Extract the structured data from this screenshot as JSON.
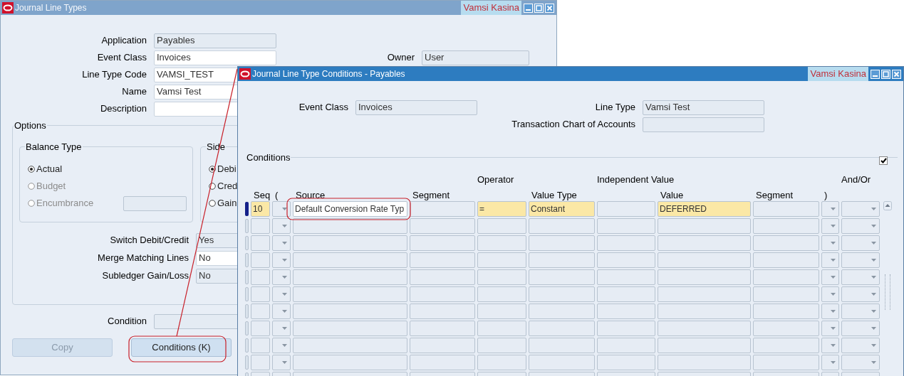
{
  "back_window": {
    "title": "Journal Line Types",
    "user": "Vamsi Kasina",
    "active": false,
    "fields": [
      {
        "label": "Application",
        "value": "Payables",
        "editable": false
      },
      {
        "label": "Event Class",
        "value": "Invoices",
        "editable": true
      },
      {
        "label": "Line Type Code",
        "value": "VAMSI_TEST",
        "editable": true
      },
      {
        "label": "Name",
        "value": "Vamsi Test",
        "editable": true
      },
      {
        "label": "Description",
        "editable": true
      }
    ],
    "owner": {
      "label": "Owner",
      "value": "User",
      "editable": false
    },
    "options": {
      "title": "Options",
      "balance_type": {
        "title": "Balance Type",
        "radios": [
          {
            "label": "Actual",
            "selected": true,
            "disabled": false
          },
          {
            "label": "Budget",
            "selected": false,
            "disabled": true
          },
          {
            "label": "Encumbrance",
            "selected": false,
            "disabled": true,
            "field": {
              "editable": false
            }
          }
        ]
      },
      "side": {
        "title": "Side",
        "radios": [
          {
            "label": "Debi",
            "selected": true,
            "disabled": false
          },
          {
            "label": "Cred",
            "selected": false,
            "disabled": false
          },
          {
            "label": "Gain",
            "selected": false,
            "disabled": false
          }
        ]
      },
      "settings": [
        {
          "label": "Switch Debit/Credit",
          "value": "Yes",
          "editable": false
        },
        {
          "label": "Merge Matching Lines",
          "value": "No",
          "editable": true
        },
        {
          "label": "Subledger Gain/Loss",
          "value": "No",
          "editable": false
        }
      ]
    },
    "condition": {
      "label": "Condition",
      "editable": false
    },
    "buttons": [
      {
        "label": "Copy",
        "disabled": true
      },
      {
        "label": "Conditions (K)",
        "disabled": false
      }
    ]
  },
  "front_window": {
    "title": "Journal Line Type Conditions - Payables",
    "user": "Vamsi Kasina",
    "active": true,
    "left_fields": [
      {
        "label": "Event Class",
        "value": "Invoices"
      }
    ],
    "right_fields": [
      {
        "label": "Line Type",
        "value": "Vamsi Test"
      },
      {
        "label": "Transaction Chart of Accounts"
      }
    ],
    "conditions": {
      "title": "Conditions",
      "checked": true,
      "columns": [
        {
          "label": "Seq",
          "kind": "text",
          "required": true
        },
        {
          "label": "(",
          "kind": "dropdown"
        },
        {
          "label": "Source",
          "kind": "lov"
        },
        {
          "label": "Segment",
          "kind": "text"
        },
        {
          "group": "Operator",
          "kind": "text",
          "required": true
        },
        {
          "label": "Value Type",
          "kind": "text",
          "required": true
        },
        {
          "group": "Independent Value",
          "kind": "text"
        },
        {
          "label": "Value",
          "kind": "text",
          "required": true
        },
        {
          "label": "Segment",
          "kind": "text"
        },
        {
          "label": ")",
          "kind": "dropdown"
        },
        {
          "group": "And/Or",
          "kind": "dropdown"
        }
      ],
      "rows": [
        {
          "selected": true,
          "cells": [
            "10",
            null,
            "Default Conversion Rate Typ",
            null,
            "=",
            "Constant",
            null,
            "DEFERRED",
            null,
            null,
            null
          ]
        },
        {
          "selected": false
        },
        {
          "selected": false
        },
        {
          "selected": false
        },
        {
          "selected": false
        },
        {
          "selected": false
        },
        {
          "selected": false
        },
        {
          "selected": false
        },
        {
          "selected": false
        },
        {
          "selected": false
        },
        {
          "selected": false
        }
      ]
    }
  }
}
